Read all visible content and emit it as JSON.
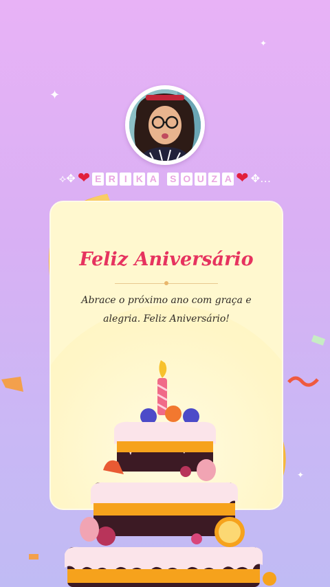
{
  "profile": {
    "name_letters": [
      "E",
      "R",
      "I",
      "K",
      "A",
      "",
      "S",
      "O",
      "U",
      "Z",
      "A"
    ],
    "name_decoration_left": "⟡✥",
    "name_decoration_right": "✥…"
  },
  "card": {
    "title": "Feliz Aniversário",
    "message_line1": "Abrace o próximo ano com graça e",
    "message_line2": "alegria. Feliz Aniversário!"
  },
  "colors": {
    "background_top": "#e8b2f6",
    "background_bottom": "#c0bbf4",
    "card": "#fff8cf",
    "title": "#e6335f",
    "heart": "#e21f3b",
    "ribbon": "#f6b83b"
  },
  "icons": [
    "sparkle-icon",
    "heart-icon",
    "ribbon-icon",
    "birthday-cake-icon",
    "candle-icon"
  ]
}
